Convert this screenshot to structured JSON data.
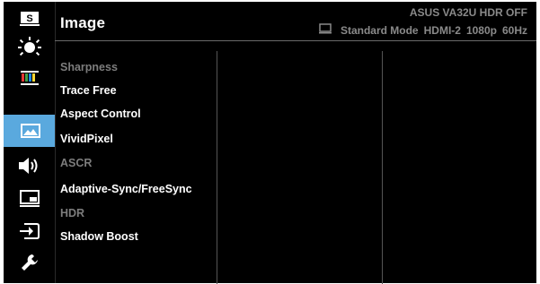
{
  "header": {
    "title": "Image",
    "model": "ASUS  VA32U HDR OFF",
    "status": {
      "mode": "Standard Mode",
      "input": "HDMI-2",
      "resolution": "1080p",
      "refresh": "60Hz"
    }
  },
  "sidebar": {
    "items": [
      {
        "icon": "splendid-icon",
        "label_char": "S",
        "active": false
      },
      {
        "icon": "brightness-icon",
        "active": false
      },
      {
        "icon": "color-icon",
        "active": false
      },
      {
        "icon": "image-icon",
        "active": true
      },
      {
        "icon": "sound-icon",
        "active": false
      },
      {
        "icon": "pip-icon",
        "active": false
      },
      {
        "icon": "input-select-icon",
        "active": false
      },
      {
        "icon": "system-setup-icon",
        "active": false
      }
    ]
  },
  "menu": {
    "items": [
      {
        "label": "Sharpness",
        "enabled": false
      },
      {
        "label": "Trace Free",
        "enabled": true
      },
      {
        "label": "Aspect Control",
        "enabled": true
      },
      {
        "label": "VividPixel",
        "enabled": true
      },
      {
        "label": "ASCR",
        "enabled": false
      },
      {
        "label": "Adaptive-Sync/FreeSync",
        "enabled": true
      },
      {
        "label": "HDR",
        "enabled": false
      },
      {
        "label": "Shadow Boost",
        "enabled": true
      }
    ]
  },
  "colors": {
    "accent": "#5aa9de",
    "background": "#000000",
    "text": "#ffffff",
    "disabled_text": "#7d7d7d",
    "status_text": "#8a8a8a"
  }
}
